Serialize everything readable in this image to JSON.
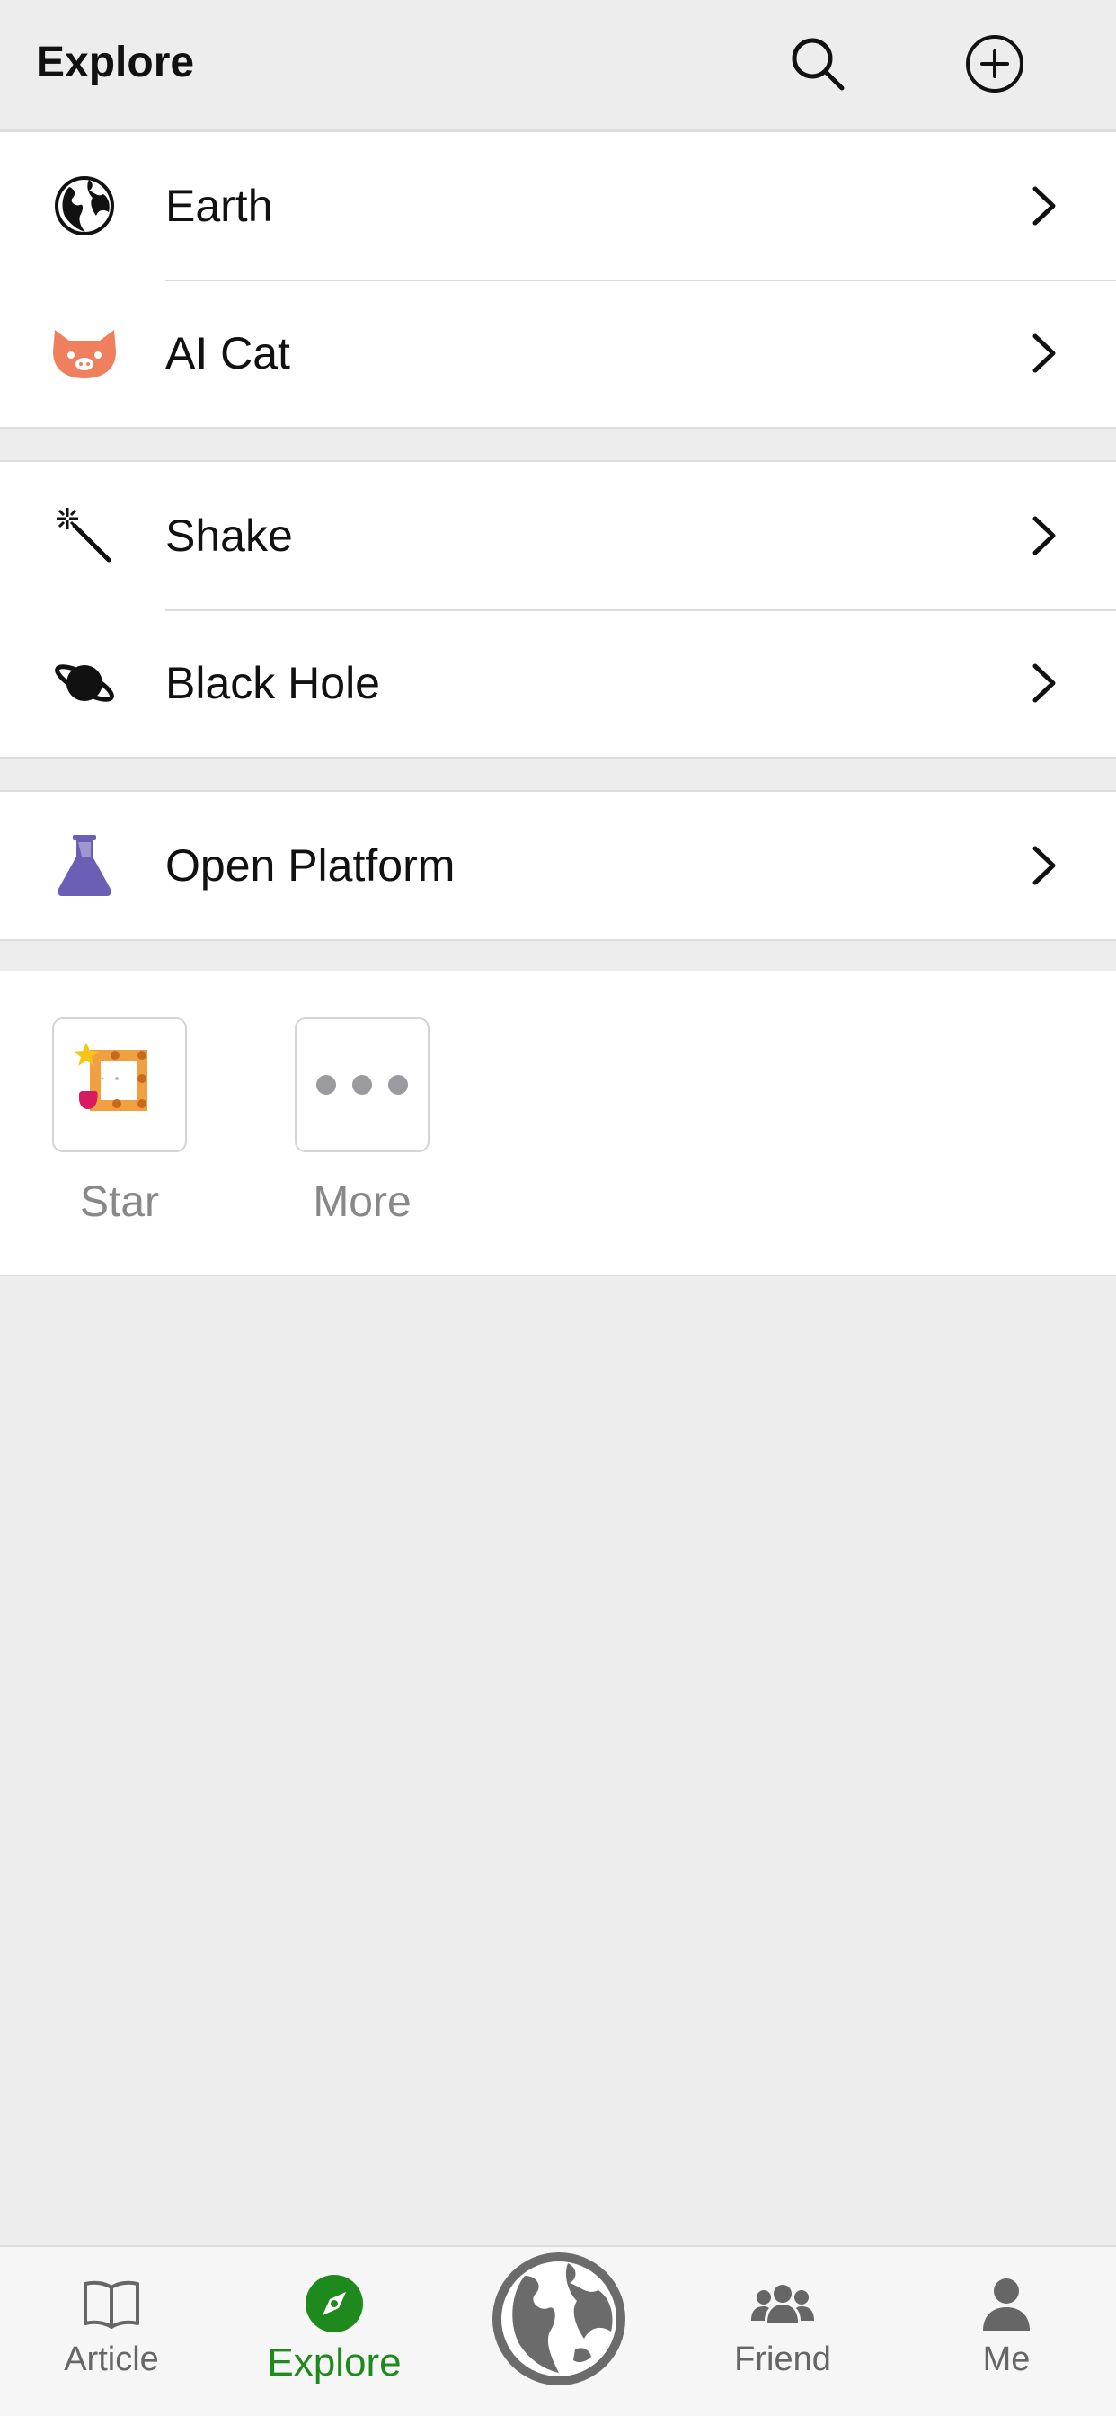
{
  "header": {
    "title": "Explore",
    "search_icon": "search-icon",
    "add_icon": "plus-circle-icon"
  },
  "groups": [
    {
      "items": [
        {
          "label": "Earth",
          "icon": "globe-icon"
        },
        {
          "label": "AI Cat",
          "icon": "cat-icon"
        }
      ]
    },
    {
      "items": [
        {
          "label": "Shake",
          "icon": "magic-wand-icon"
        },
        {
          "label": "Black Hole",
          "icon": "planet-icon"
        }
      ]
    },
    {
      "items": [
        {
          "label": "Open Platform",
          "icon": "flask-icon"
        }
      ]
    }
  ],
  "apps": [
    {
      "label": "Star",
      "icon": "star-app-icon"
    },
    {
      "label": "More",
      "icon": "more-dots-icon"
    }
  ],
  "tabbar": {
    "tabs": [
      {
        "label": "Article",
        "icon": "book-icon",
        "active": false
      },
      {
        "label": "Explore",
        "icon": "compass-icon",
        "active": true
      },
      {
        "label": "Friend",
        "icon": "people-icon",
        "active": false
      },
      {
        "label": "Me",
        "icon": "person-icon",
        "active": false
      }
    ],
    "center_icon": "globe-icon"
  },
  "colors": {
    "accent": "#1e8a1e",
    "cat": "#f07f5d",
    "flask": "#6a5fb5",
    "background": "#ededed"
  }
}
